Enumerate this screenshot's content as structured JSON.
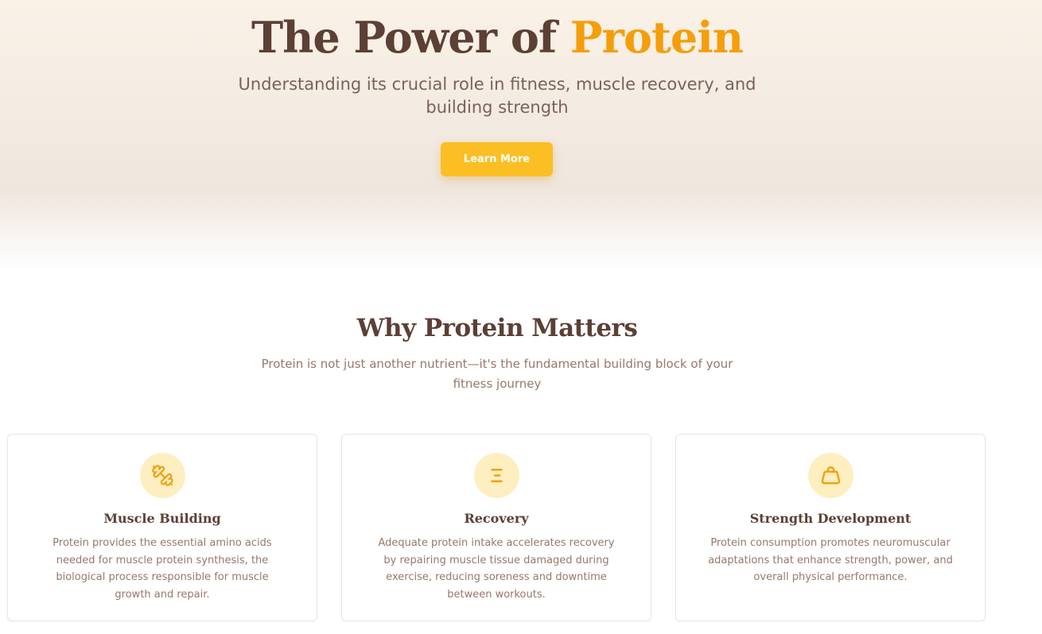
{
  "hero": {
    "title_main": "The Power of",
    "title_accent": "Protein",
    "subtitle": "Understanding its crucial role in fitness, muscle recovery, and building strength",
    "button_label": "Learn More"
  },
  "why": {
    "title": "Why Protein Matters",
    "description": "Protein is not just another nutrient—it's the fundamental building block of your fitness journey"
  },
  "cards": [
    {
      "icon": "dumbbell-icon",
      "title": "Muscle Building",
      "text": "Protein provides the essential amino acids needed for muscle protein synthesis, the biological process responsible for muscle growth and repair."
    },
    {
      "icon": "list-lines-icon",
      "title": "Recovery",
      "text": "Adequate protein intake accelerates recovery by repairing muscle tissue damaged during exercise, reducing soreness and downtime between workouts."
    },
    {
      "icon": "weight-icon",
      "title": "Strength Development",
      "text": "Protein consumption promotes neuromuscular adaptations that enhance strength, power, and overall physical performance."
    }
  ],
  "colors": {
    "accent": "#f59e0b",
    "button": "#fbbf24",
    "heading": "#5c3f35",
    "body_text": "#96786a",
    "icon_bg": "#fdefc0"
  }
}
